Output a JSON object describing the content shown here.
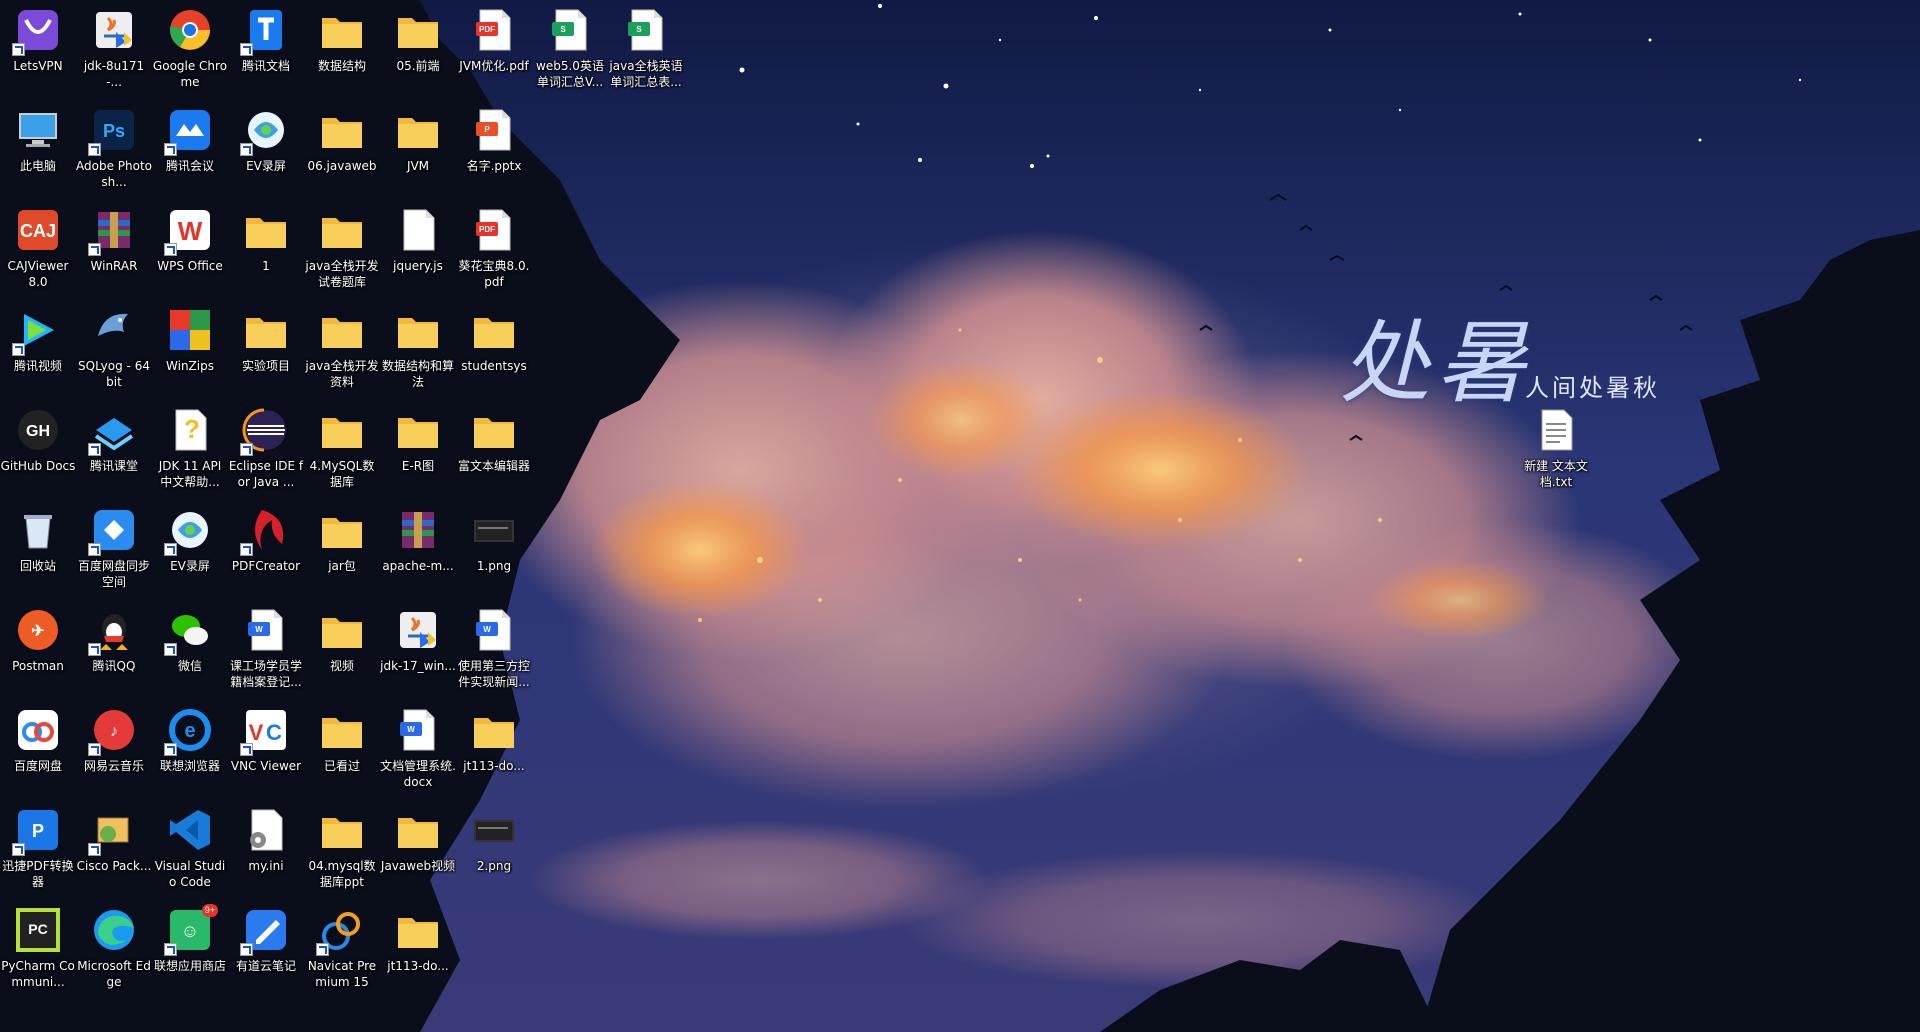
{
  "desktop": {
    "columns": [
      [
        {
          "label": "LetsVPN",
          "icon": "letsvpn-icon",
          "shortcut": true
        },
        {
          "label": "此电脑",
          "icon": "computer-icon",
          "shortcut": false
        },
        {
          "label": "CAJViewer 8.0",
          "icon": "cajviewer-icon",
          "shortcut": false
        },
        {
          "label": "腾讯视频",
          "icon": "tencent-video-icon",
          "shortcut": true
        },
        {
          "label": "GitHub Docs",
          "icon": "github-icon",
          "shortcut": false
        },
        {
          "label": "回收站",
          "icon": "recycle-bin-icon",
          "shortcut": false
        },
        {
          "label": "Postman",
          "icon": "postman-icon",
          "shortcut": false
        },
        {
          "label": "百度网盘",
          "icon": "baidu-netdisk-icon",
          "shortcut": false
        },
        {
          "label": "迅捷PDF转换器",
          "icon": "pdf-converter-icon",
          "shortcut": true
        },
        {
          "label": "PyCharm Communi...",
          "icon": "pycharm-icon",
          "shortcut": false
        }
      ],
      [
        {
          "label": "jdk-8u171-...",
          "icon": "java-installer-icon",
          "shortcut": false
        },
        {
          "label": "Adobe Photosh...",
          "icon": "photoshop-icon",
          "shortcut": true
        },
        {
          "label": "WinRAR",
          "icon": "winrar-icon",
          "shortcut": true
        },
        {
          "label": "SQLyog - 64 bit",
          "icon": "sqlyog-icon",
          "shortcut": false
        },
        {
          "label": "腾讯课堂",
          "icon": "tencent-classroom-icon",
          "shortcut": true
        },
        {
          "label": "百度网盘同步空间",
          "icon": "baidu-sync-icon",
          "shortcut": true
        },
        {
          "label": "腾讯QQ",
          "icon": "qq-icon",
          "shortcut": true
        },
        {
          "label": "网易云音乐",
          "icon": "netease-music-icon",
          "shortcut": true
        },
        {
          "label": "Cisco Pack...",
          "icon": "cisco-packet-icon",
          "shortcut": true
        },
        {
          "label": "Microsoft Edge",
          "icon": "edge-icon",
          "shortcut": false
        }
      ],
      [
        {
          "label": "Google Chrome",
          "icon": "chrome-icon",
          "shortcut": false
        },
        {
          "label": "腾讯会议",
          "icon": "tencent-meeting-icon",
          "shortcut": true
        },
        {
          "label": "WPS Office",
          "icon": "wps-icon",
          "shortcut": true
        },
        {
          "label": "WinZips",
          "icon": "winzip-icon",
          "shortcut": false
        },
        {
          "label": "JDK 11 API 中文帮助...",
          "icon": "help-file-icon",
          "shortcut": false
        },
        {
          "label": "EV录屏",
          "icon": "ev-recorder-icon",
          "shortcut": true
        },
        {
          "label": "微信",
          "icon": "wechat-icon",
          "shortcut": true
        },
        {
          "label": "联想浏览器",
          "icon": "lenovo-browser-icon",
          "shortcut": true
        },
        {
          "label": "Visual Studio Code",
          "icon": "vscode-icon",
          "shortcut": false
        },
        {
          "label": "联想应用商店",
          "icon": "lenovo-store-icon",
          "shortcut": true,
          "badge": "9+"
        }
      ],
      [
        {
          "label": "腾讯文档",
          "icon": "tencent-docs-icon",
          "shortcut": true
        },
        {
          "label": "EV录屏",
          "icon": "ev-recorder-icon",
          "shortcut": true
        },
        {
          "label": "1",
          "icon": "folder-icon",
          "shortcut": false
        },
        {
          "label": "实验项目",
          "icon": "folder-icon",
          "shortcut": false
        },
        {
          "label": "Eclipse IDE for Java ...",
          "icon": "eclipse-icon",
          "shortcut": true
        },
        {
          "label": "PDFCreator",
          "icon": "pdfcreator-icon",
          "shortcut": true
        },
        {
          "label": "课工场学员学籍档案登记...",
          "icon": "word-doc-icon",
          "shortcut": false
        },
        {
          "label": "VNC Viewer",
          "icon": "vnc-icon",
          "shortcut": true
        },
        {
          "label": "my.ini",
          "icon": "ini-file-icon",
          "shortcut": false
        },
        {
          "label": "有道云笔记",
          "icon": "youdao-note-icon",
          "shortcut": true
        }
      ],
      [
        {
          "label": "数据结构",
          "icon": "folder-icon",
          "shortcut": false
        },
        {
          "label": "06.javaweb",
          "icon": "folder-icon",
          "shortcut": false
        },
        {
          "label": "java全栈开发试卷题库",
          "icon": "folder-icon",
          "shortcut": false
        },
        {
          "label": "java全栈开发资料",
          "icon": "folder-icon",
          "shortcut": false
        },
        {
          "label": "4.MySQL数据库",
          "icon": "folder-icon",
          "shortcut": false
        },
        {
          "label": "jar包",
          "icon": "folder-icon",
          "shortcut": false
        },
        {
          "label": "视频",
          "icon": "folder-icon",
          "shortcut": false
        },
        {
          "label": "已看过",
          "icon": "folder-icon",
          "shortcut": false
        },
        {
          "label": "04.mysql数据库ppt",
          "icon": "folder-icon",
          "shortcut": false
        },
        {
          "label": "Navicat Premium 15",
          "icon": "navicat-icon",
          "shortcut": true
        }
      ],
      [
        {
          "label": "05.前端",
          "icon": "folder-icon",
          "shortcut": false
        },
        {
          "label": "JVM",
          "icon": "folder-icon",
          "shortcut": false
        },
        {
          "label": "jquery.js",
          "icon": "blank-file-icon",
          "shortcut": false
        },
        {
          "label": "数据结构和算法",
          "icon": "folder-icon",
          "shortcut": false
        },
        {
          "label": "E-R图",
          "icon": "folder-icon",
          "shortcut": false
        },
        {
          "label": "apache-m...",
          "icon": "winrar-archive-icon",
          "shortcut": false
        },
        {
          "label": "jdk-17_win...",
          "icon": "java-installer-icon",
          "shortcut": false
        },
        {
          "label": "文档管理系统.docx",
          "icon": "word-doc-icon",
          "shortcut": false
        },
        {
          "label": "Javaweb视频",
          "icon": "folder-icon",
          "shortcut": false
        },
        {
          "label": "jt113-do...",
          "icon": "folder-icon",
          "shortcut": false
        }
      ],
      [
        {
          "label": "JVM优化.pdf",
          "icon": "pdf-icon",
          "shortcut": false
        },
        {
          "label": "名字.pptx",
          "icon": "pptx-icon",
          "shortcut": false
        },
        {
          "label": "葵花宝典8.0.pdf",
          "icon": "pdf-icon",
          "shortcut": false
        },
        {
          "label": "studentsys",
          "icon": "folder-icon",
          "shortcut": false
        },
        {
          "label": "富文本编辑器",
          "icon": "folder-icon",
          "shortcut": false
        },
        {
          "label": "1.png",
          "icon": "image-file-icon",
          "shortcut": false
        },
        {
          "label": "使用第三方控件实现新闻...",
          "icon": "word-doc-icon",
          "shortcut": false
        },
        {
          "label": "jt113-do...",
          "icon": "folder-icon",
          "shortcut": false
        },
        {
          "label": "2.png",
          "icon": "image-file-icon",
          "shortcut": false
        }
      ],
      [
        {
          "label": "web5.0英语单词汇总V...",
          "icon": "spreadsheet-icon",
          "shortcut": false
        }
      ],
      [
        {
          "label": "java全栈英语单词汇总表...",
          "icon": "spreadsheet-icon",
          "shortcut": false
        }
      ]
    ],
    "floating": [
      {
        "label": "新建 文本文档.txt",
        "icon": "text-file-icon",
        "shortcut": false
      }
    ]
  },
  "wallpaper": {
    "calligraphy_title": "处暑",
    "calligraphy_subtitle": "人间处暑秋"
  },
  "colors": {
    "sky_top": "#16204d",
    "sky_mid": "#2d3a7a",
    "cloud_pink": "#e8a79a",
    "cloud_glow": "#ffc26a",
    "folder_yellow": "#f6c443",
    "tree_dark": "#0a0e1a"
  }
}
